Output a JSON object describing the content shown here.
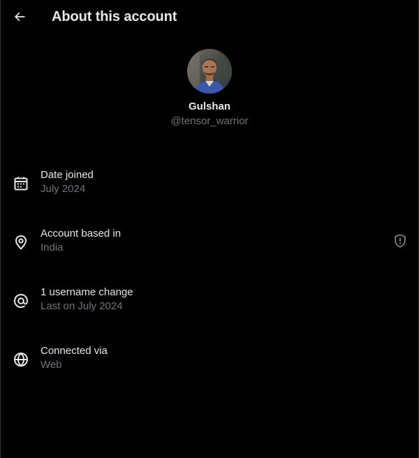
{
  "header": {
    "title": "About this account"
  },
  "profile": {
    "display_name": "Gulshan",
    "handle": "@tensor_warrior"
  },
  "details": [
    {
      "icon": "calendar-icon",
      "label": "Date joined",
      "value": "July 2024"
    },
    {
      "icon": "location-pin-icon",
      "label": "Account based in",
      "value": "India",
      "action_icon": "shield-info-icon"
    },
    {
      "icon": "at-sign-icon",
      "label": "1 username change",
      "value": "Last on July 2024"
    },
    {
      "icon": "globe-icon",
      "label": "Connected via",
      "value": "Web"
    }
  ],
  "colors": {
    "background": "#000000",
    "primary_text": "#e7e9ea",
    "secondary_text": "#71767b"
  }
}
